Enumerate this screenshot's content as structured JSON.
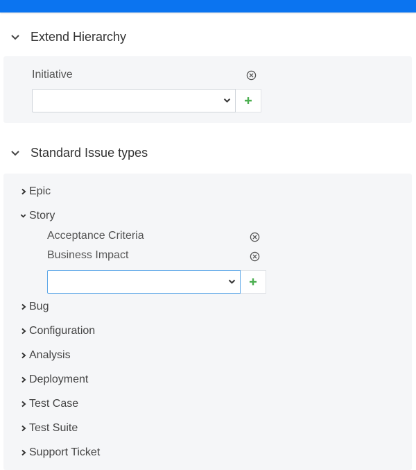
{
  "colors": {
    "topbar": "#0b74f0",
    "panel_bg": "#f5f6f8",
    "add_icon": "#4caf50",
    "text": "#333333"
  },
  "extend_hierarchy": {
    "title": "Extend Hierarchy",
    "icon": "chevron-down-icon",
    "field_label": "Initiative",
    "select_value": ""
  },
  "standard_issue_types": {
    "title": "Standard Issue types",
    "icon": "chevron-down-icon",
    "items": [
      {
        "label": "Epic",
        "expanded": false
      },
      {
        "label": "Story",
        "expanded": true,
        "fields": [
          {
            "label": "Acceptance Criteria"
          },
          {
            "label": "Business Impact"
          }
        ],
        "select_value": ""
      },
      {
        "label": "Bug",
        "expanded": false
      },
      {
        "label": "Configuration",
        "expanded": false
      },
      {
        "label": "Analysis",
        "expanded": false
      },
      {
        "label": "Deployment",
        "expanded": false
      },
      {
        "label": "Test Case",
        "expanded": false
      },
      {
        "label": "Test Suite",
        "expanded": false
      },
      {
        "label": "Support Ticket",
        "expanded": false
      }
    ]
  }
}
